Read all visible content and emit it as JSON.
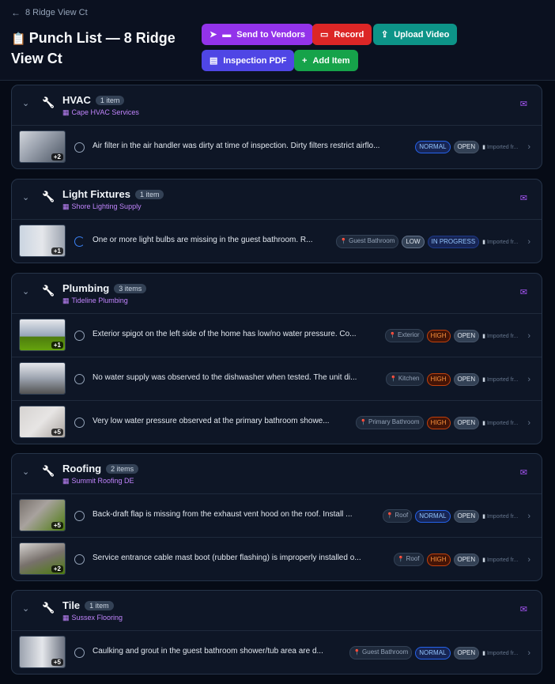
{
  "header": {
    "back_label": "8 Ridge View Ct",
    "title_icon": "📋",
    "title": "Punch List — 8 Ridge View Ct",
    "buttons": {
      "send_vendors": "Send to Vendors",
      "record": "Record",
      "upload_video": "Upload Video",
      "inspection_pdf": "Inspection PDF",
      "add_item": "Add Item"
    }
  },
  "colors": {
    "send_vendors": "#9333ea",
    "record": "#dc2626",
    "upload_video": "#0d9488",
    "inspection_pdf": "#4f46e5",
    "add_item": "#16a34a",
    "vendor_text": "#c084fc"
  },
  "categories": [
    {
      "name": "HVAC",
      "count": "1 item",
      "vendor": "Cape HVAC Services",
      "items": [
        {
          "thumb_plus": "+2",
          "status": "open-circle",
          "desc": "Air filter in the air handler was dirty at time of inspection. Dirty filters restrict airflo...",
          "location": "",
          "priority": "NORMAL",
          "state": "OPEN",
          "imported": "Imported fr..."
        }
      ]
    },
    {
      "name": "Light Fixtures",
      "count": "1 item",
      "vendor": "Shore Lighting Supply",
      "items": [
        {
          "thumb_plus": "+1",
          "status": "in-progress",
          "desc": "One or more light bulbs are missing in the guest bathroom. R...",
          "location": "Guest Bathroom",
          "priority": "LOW",
          "state": "IN PROGRESS",
          "imported": "Imported fr..."
        }
      ]
    },
    {
      "name": "Plumbing",
      "count": "3 items",
      "vendor": "Tideline Plumbing",
      "items": [
        {
          "thumb_plus": "+1",
          "status": "open-circle",
          "desc": "Exterior spigot on the left side of the home has low/no water pressure. Co...",
          "location": "Exterior",
          "priority": "HIGH",
          "state": "OPEN",
          "imported": "Imported fr..."
        },
        {
          "thumb_plus": "",
          "status": "open-circle",
          "desc": "No water supply was observed to the dishwasher when tested. The unit di...",
          "location": "Kitchen",
          "priority": "HIGH",
          "state": "OPEN",
          "imported": "Imported fr..."
        },
        {
          "thumb_plus": "+5",
          "status": "open-circle",
          "desc": "Very low water pressure observed at the primary bathroom showe...",
          "location": "Primary Bathroom",
          "priority": "HIGH",
          "state": "OPEN",
          "imported": "Imported fr..."
        }
      ]
    },
    {
      "name": "Roofing",
      "count": "2 items",
      "vendor": "Summit Roofing DE",
      "items": [
        {
          "thumb_plus": "+5",
          "status": "open-circle",
          "desc": "Back-draft flap is missing from the exhaust vent hood on the roof. Install ...",
          "location": "Roof",
          "priority": "NORMAL",
          "state": "OPEN",
          "imported": "Imported fr..."
        },
        {
          "thumb_plus": "+2",
          "status": "open-circle",
          "desc": "Service entrance cable mast boot (rubber flashing) is improperly installed o...",
          "location": "Roof",
          "priority": "HIGH",
          "state": "OPEN",
          "imported": "Imported fr..."
        }
      ]
    },
    {
      "name": "Tile",
      "count": "1 item",
      "vendor": "Sussex Flooring",
      "items": [
        {
          "thumb_plus": "+5",
          "status": "open-circle",
          "desc": "Caulking and grout in the guest bathroom shower/tub area are d...",
          "location": "Guest Bathroom",
          "priority": "NORMAL",
          "state": "OPEN",
          "imported": "Imported fr..."
        }
      ]
    }
  ]
}
